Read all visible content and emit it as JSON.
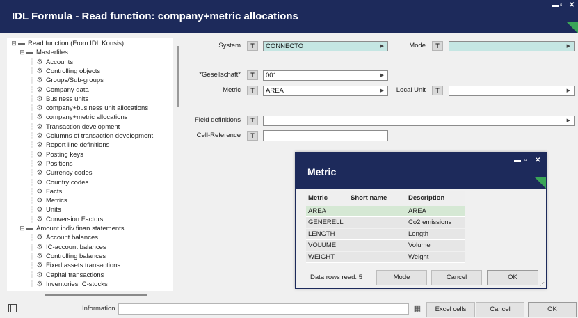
{
  "window": {
    "title": "IDL Formula - Read function: company+metric allocations"
  },
  "tree": {
    "items": [
      {
        "label": "Read function (From IDL Konsis)",
        "icon": "folder-icon",
        "level": 0,
        "toggle": "−"
      },
      {
        "label": "Masterfiles",
        "icon": "folder-icon",
        "level": 1,
        "toggle": "−"
      },
      {
        "label": "Accounts",
        "icon": "gear-icon",
        "level": 2
      },
      {
        "label": "Controlling objects",
        "icon": "gear-icon",
        "level": 2
      },
      {
        "label": "Groups/Sub-groups",
        "icon": "gear-icon",
        "level": 2
      },
      {
        "label": "Company data",
        "icon": "gear-icon",
        "level": 2
      },
      {
        "label": "Business units",
        "icon": "gear-icon",
        "level": 2
      },
      {
        "label": "company+business unit allocations",
        "icon": "gear-icon",
        "level": 2
      },
      {
        "label": "company+metric allocations",
        "icon": "gear-icon",
        "level": 2
      },
      {
        "label": "Transaction development",
        "icon": "gear-icon",
        "level": 2
      },
      {
        "label": "Columns of transaction development",
        "icon": "gear-icon",
        "level": 2
      },
      {
        "label": "Report line definitions",
        "icon": "gear-icon",
        "level": 2
      },
      {
        "label": "Posting keys",
        "icon": "gear-icon",
        "level": 2
      },
      {
        "label": "Positions",
        "icon": "gear-icon",
        "level": 2
      },
      {
        "label": "Currency codes",
        "icon": "gear-icon",
        "level": 2
      },
      {
        "label": "Country codes",
        "icon": "gear-icon",
        "level": 2
      },
      {
        "label": "Facts",
        "icon": "gear-icon",
        "level": 2
      },
      {
        "label": "Metrics",
        "icon": "gear-icon",
        "level": 2
      },
      {
        "label": "Units",
        "icon": "gear-icon",
        "level": 2
      },
      {
        "label": "Conversion Factors",
        "icon": "gear-icon",
        "level": 2
      },
      {
        "label": "Amount indiv.finan.statements",
        "icon": "folder-icon",
        "level": 1,
        "toggle": "−"
      },
      {
        "label": "Account balances",
        "icon": "gear-icon",
        "level": 2
      },
      {
        "label": "IC-account balances",
        "icon": "gear-icon",
        "level": 2
      },
      {
        "label": "Controlling balances",
        "icon": "gear-icon",
        "level": 2
      },
      {
        "label": "Fixed assets transactions",
        "icon": "gear-icon",
        "level": 2
      },
      {
        "label": "Capital transactions",
        "icon": "gear-icon",
        "level": 2
      },
      {
        "label": "Inventories IC-stocks",
        "icon": "gear-icon",
        "level": 2
      }
    ]
  },
  "form": {
    "system_label": "System",
    "system_value": "CONNECTO",
    "mode_label": "Mode",
    "mode_value": "",
    "gesellschaft_label": "*Gesellschaft*",
    "gesellschaft_value": "001",
    "metric_label": "Metric",
    "metric_value": "AREA",
    "local_unit_label": "Local Unit",
    "local_unit_value": "",
    "field_definitions_label": "Field definitions",
    "field_definitions_value": "",
    "cell_reference_label": "Cell-Reference",
    "cell_reference_value": "",
    "t_button": "T"
  },
  "dialog": {
    "title": "Metric",
    "columns": [
      "Metric",
      "Short name",
      "Description"
    ],
    "rows": [
      [
        "AREA",
        "",
        "AREA"
      ],
      [
        "GENERELL",
        "",
        "Co2 emissions"
      ],
      [
        "LENGTH",
        "",
        "Length"
      ],
      [
        "VOLUME",
        "",
        "Volume"
      ],
      [
        "WEIGHT",
        "",
        "Weight"
      ]
    ],
    "rows_read": "Data rows read: 5",
    "mode_button": "Mode",
    "cancel_button": "Cancel",
    "ok_button": "OK"
  },
  "statusbar": {
    "information_label": "Information",
    "information_value": "",
    "excel_button": "Excel cells",
    "cancel_button": "Cancel",
    "ok_button": "OK"
  },
  "colors": {
    "titlebar": "#1d2a5b",
    "accent_green": "#3aa557",
    "teal_field": "#c5e6e3",
    "selected_row": "#d5e8d4"
  }
}
